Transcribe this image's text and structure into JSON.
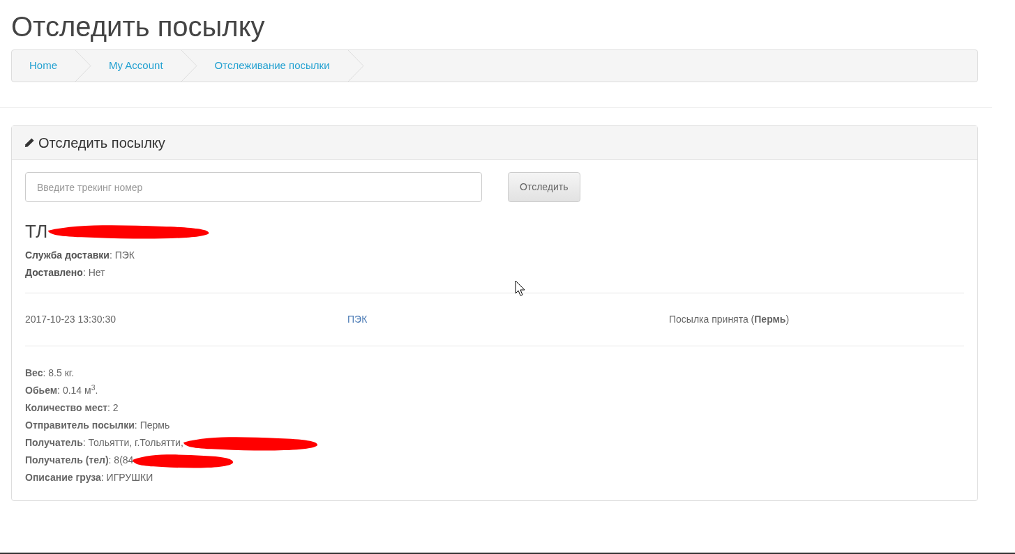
{
  "page_title": "Отследить посылку",
  "breadcrumbs": [
    {
      "label": "Home"
    },
    {
      "label": "My Account"
    },
    {
      "label": "Отслеживание посылки"
    }
  ],
  "panel": {
    "title": "Отследить посылку",
    "tracking_field": {
      "placeholder": "Введите трекинг номер"
    },
    "track_button": "Отследить",
    "tracking_number": {
      "text": "ТЛ",
      "redacted": true
    },
    "summary": [
      "**Служба доставки**: ПЭК",
      "**Доставлено**: Нет"
    ],
    "events": [
      {
        "date": "2017-10-23 13:30:30",
        "carrier": "ПЭК",
        "status": "Посылка принята (**Пермь**)"
      }
    ],
    "details": [
      {
        "text": "**Вес**: 8.5 кг.",
        "redacted": false
      },
      {
        "text": "**Обьем**: 0.14 м$^{3}$.",
        "redacted": false
      },
      {
        "text": "**Количество мест**: 2",
        "redacted": false
      },
      {
        "text": "**Отправитель посылки**: Пермь",
        "redacted": false
      },
      {
        "text": "**Получатель**: Тольятти, г.Тольятти,",
        "redacted": true
      },
      {
        "text": "**Получатель (тел)**: 8(84",
        "redacted": true
      },
      {
        "text": "**Описание груза**: ИГРУШКИ",
        "redacted": false
      }
    ]
  }
}
